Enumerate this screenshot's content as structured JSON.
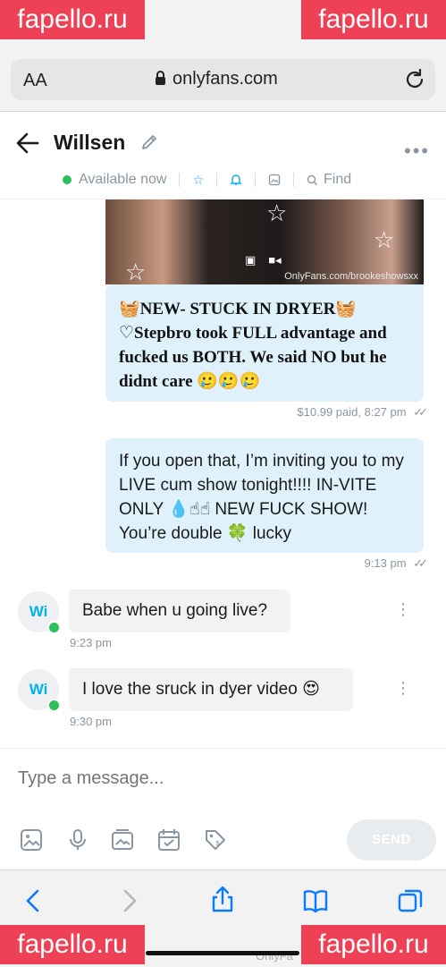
{
  "browser": {
    "text_size_label": "AA",
    "url": "onlyfans.com"
  },
  "chat": {
    "title": "Willsen",
    "status": "Available now",
    "find_label": "Find",
    "accent": "#00aff0",
    "online_color": "#2dbf5a"
  },
  "messages": [
    {
      "direction": "out",
      "media_caption": "OnlyFans.com/brookeshowsxx",
      "text": "🧺NEW- STUCK IN DRYER🧺 ♡Stepbro took FULL advantage and fucked us BOTH. We said NO but he didnt care 🥲🥲🥲",
      "meta": "$10.99 paid, 8:27 pm"
    },
    {
      "direction": "out",
      "text": "If you open that, I’m inviting you to my LIVE cum show tonight!!!! IN-VITE ONLY 💧☝☝ NEW FUCK SHOW! You’re double 🍀 lucky",
      "meta": "9:13 pm"
    },
    {
      "direction": "in",
      "avatar": "Wi",
      "text": "Babe when u going live?",
      "time": "9:23 pm"
    },
    {
      "direction": "in",
      "avatar": "Wi",
      "text": "I love the sruck in dyer video 😍",
      "time": "9:30 pm"
    }
  ],
  "composer": {
    "placeholder": "Type a message...",
    "send_label": "SEND"
  },
  "footer_mark": "OnlyFa",
  "watermark": "fapello.ru",
  "watermark_color": "#ef4156"
}
